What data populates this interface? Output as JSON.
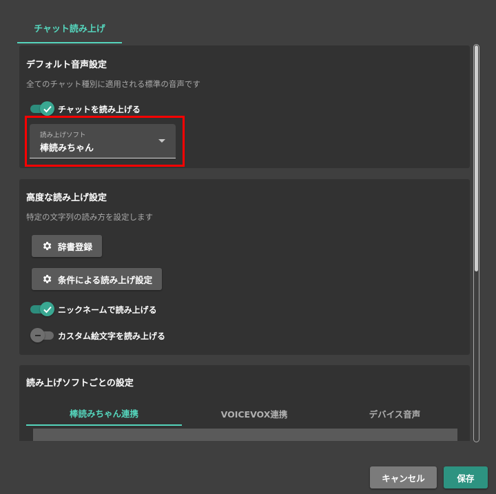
{
  "top_tab": {
    "label": "チャット読み上げ"
  },
  "default_voice": {
    "title": "デフォルト音声設定",
    "subtitle": "全てのチャット種別に適用される標準の音声です",
    "toggle_label": "チャットを読み上げる",
    "toggle_on": true,
    "select": {
      "label": "読み上げソフト",
      "value": "棒読みちゃん"
    }
  },
  "advanced": {
    "title": "高度な読み上げ設定",
    "subtitle": "特定の文字列の読み方を設定します",
    "dictionary_button": "辞書登録",
    "condition_button": "条件による読み上げ設定",
    "nickname_toggle_label": "ニックネームで読み上げる",
    "nickname_toggle_on": true,
    "custom_emoji_toggle_label": "カスタム絵文字を読み上げる",
    "custom_emoji_toggle_on": false
  },
  "per_software": {
    "title": "読み上げソフトごとの設定",
    "tabs": [
      {
        "label": "棒読みちゃん連携",
        "active": true
      },
      {
        "label": "VOICEVOX連携",
        "active": false
      },
      {
        "label": "デバイス音声",
        "active": false
      }
    ]
  },
  "footer": {
    "cancel_label": "キャンセル",
    "save_label": "保存"
  },
  "colors": {
    "accent": "#55d6bd",
    "save": "#2d9381",
    "highlight": "#ff0000"
  },
  "icons": {
    "toggle_check": "check-icon",
    "button": "gear-icon",
    "select": "chevron-down-icon"
  }
}
